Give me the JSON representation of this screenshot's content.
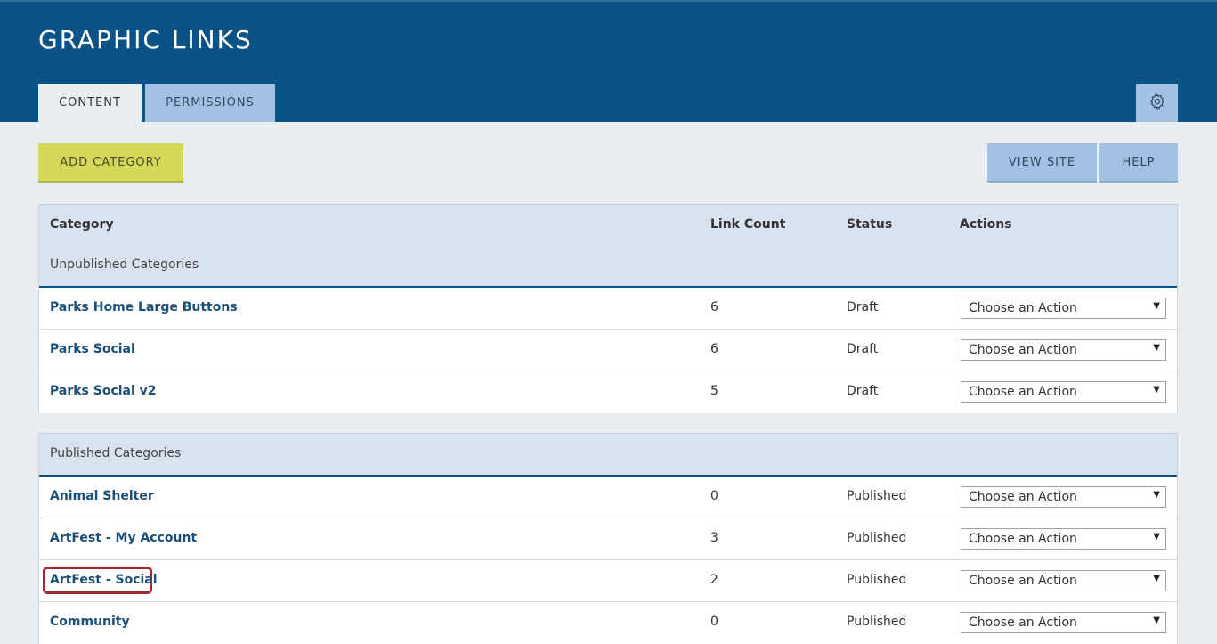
{
  "header": {
    "title": "GRAPHIC LINKS",
    "tabs": [
      {
        "label": "CONTENT"
      },
      {
        "label": "PERMISSIONS"
      }
    ],
    "settings_icon": "gear-icon"
  },
  "toolbar": {
    "add_label": "ADD CATEGORY",
    "view_site_label": "VIEW SITE",
    "help_label": "HELP"
  },
  "table": {
    "columns": {
      "category": "Category",
      "link_count": "Link Count",
      "status": "Status",
      "actions": "Actions"
    },
    "unpublished": {
      "label": "Unpublished Categories",
      "rows": [
        {
          "name": "Parks Home Large Buttons",
          "count": "6",
          "status": "Draft",
          "action": "Choose an Action"
        },
        {
          "name": "Parks Social",
          "count": "6",
          "status": "Draft",
          "action": "Choose an Action"
        },
        {
          "name": "Parks Social v2",
          "count": "5",
          "status": "Draft",
          "action": "Choose an Action"
        }
      ]
    },
    "published": {
      "label": "Published Categories",
      "rows": [
        {
          "name": "Animal Shelter",
          "count": "0",
          "status": "Published",
          "action": "Choose an Action"
        },
        {
          "name": "ArtFest - My Account",
          "count": "3",
          "status": "Published",
          "action": "Choose an Action"
        },
        {
          "name": "ArtFest - Social",
          "count": "2",
          "status": "Published",
          "action": "Choose an Action"
        },
        {
          "name": "Community",
          "count": "0",
          "status": "Published",
          "action": "Choose an Action"
        }
      ]
    }
  },
  "colors": {
    "header_bg": "#0b5386",
    "tab_inactive": "#a3c1e2",
    "add_button": "#d5d959",
    "highlight": "#9b2a33"
  }
}
